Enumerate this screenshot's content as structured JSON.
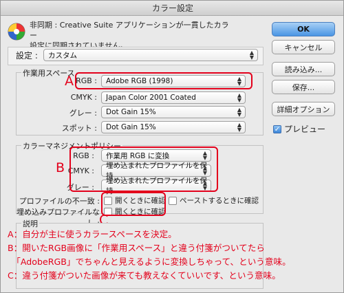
{
  "window": {
    "title": "カラー設定"
  },
  "sync": {
    "line1": "非同期 : Creative Suite アプリケーションが一貫したカラー",
    "line2": "設定に同期されていません。"
  },
  "buttons": {
    "ok": "OK",
    "cancel": "キャンセル",
    "load": "読み込み...",
    "save": "保存...",
    "advanced": "詳細オプション"
  },
  "preview": {
    "label": "プレビュー",
    "checked": true
  },
  "settings": {
    "label": "設定 :",
    "value": "カスタム"
  },
  "working_spaces": {
    "title": "作業用スペース",
    "rows": [
      {
        "label": "RGB :",
        "value": "Adobe RGB (1998)"
      },
      {
        "label": "CMYK :",
        "value": "Japan Color 2001 Coated"
      },
      {
        "label": "グレー :",
        "value": "Dot Gain 15%"
      },
      {
        "label": "スポット :",
        "value": "Dot Gain 15%"
      }
    ]
  },
  "color_management": {
    "title": "カラーマネジメントポリシー",
    "rows": [
      {
        "label": "RGB :",
        "value": "作業用 RGB に変換"
      },
      {
        "label": "CMYK :",
        "value": "埋め込まれたプロファイルを保持"
      },
      {
        "label": "グレー :",
        "value": "埋め込まれたプロファイルを保持"
      }
    ],
    "mismatch_label": "プロファイルの不一致 :",
    "missing_label": "埋め込みプロファイルなし :",
    "ask_open": "開くときに確認",
    "ask_paste": "ペーストするときに確認",
    "ask_open_missing": "開くときに確認"
  },
  "description": {
    "title": "説明"
  },
  "annotations": {
    "letters": {
      "a": "A",
      "b": "B",
      "c": "C"
    },
    "notes": [
      "A：自分が主に使うカラースペースを決定。",
      "B：開いたRGB画像に「作業用スペース」と違う付箋がついてたら",
      "　「AdobeRGB」でちゃんと見えるように変換しちゃって、という意味。",
      "C：違う付箋がついた画像が来ても教えなくていいです、という意味。"
    ],
    "color": "#e3001b"
  },
  "colors": {
    "accent": "#4a95e4",
    "window_bg": "#e9e9e9"
  }
}
